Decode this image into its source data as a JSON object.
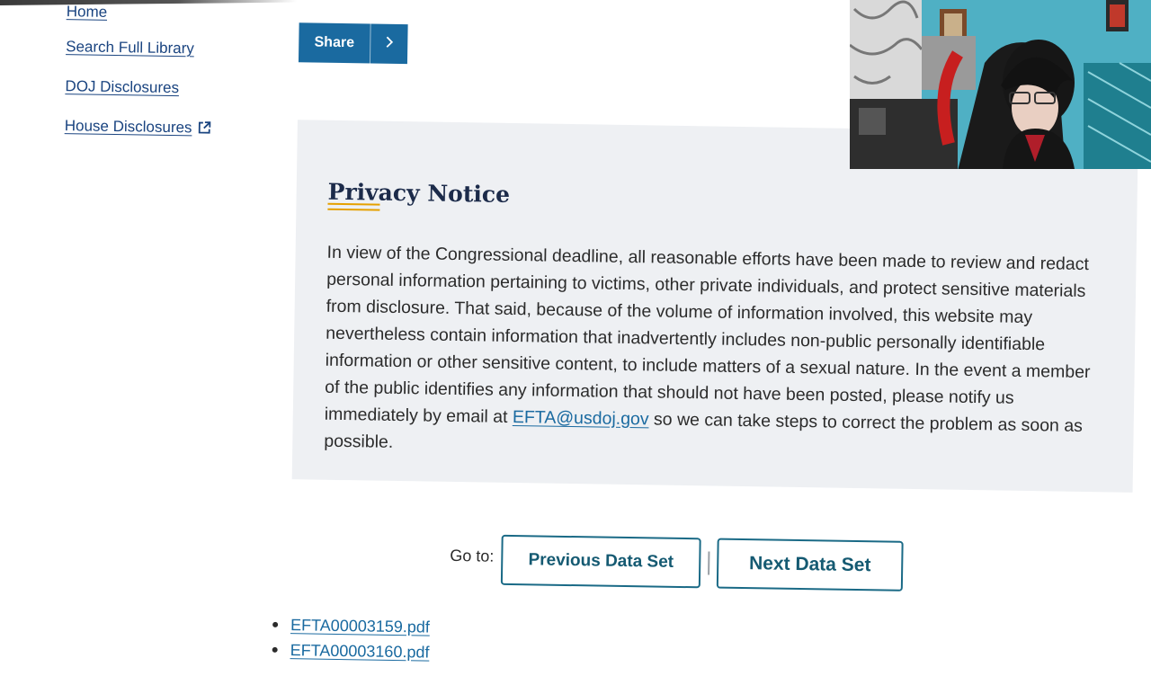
{
  "sidebar": {
    "items": [
      {
        "label": "Home"
      },
      {
        "label": "Search Full Library"
      },
      {
        "label": "DOJ Disclosures"
      },
      {
        "label": "House Disclosures",
        "icon": "external-link-icon"
      }
    ]
  },
  "share": {
    "label": "Share",
    "icon": "chevron-right-icon"
  },
  "notice": {
    "title": "Privacy Notice",
    "body_before_link": "In view of the Congressional deadline, all reasonable efforts have been made to review and redact personal information pertaining to victims, other private individuals, and protect sensitive materials from disclosure. That said, because of the volume of information involved, this website may nevertheless contain information that inadvertently includes non-public personally identifiable information or other sensitive content, to include matters of a sexual nature. In the event a member of the public identifies any information that should not have been posted, please notify us immediately by email at",
    "email": "EFTA@usdoj.gov",
    "body_after_link": "so we can take steps to correct the problem as soon as possible."
  },
  "goto": {
    "label": "Go to:",
    "prev_label": "Previous Data Set",
    "separator": "|",
    "next_label": "Next Data Set"
  },
  "files": [
    {
      "name": "EFTA00003159.pdf"
    },
    {
      "name": "EFTA00003160.pdf"
    }
  ],
  "colors": {
    "link": "#1a6aa0",
    "share_button": "#1a6aa0",
    "panel_bg": "#eef0f3",
    "accent_rule": "#e5a000",
    "nav_border": "#1a6a86"
  }
}
